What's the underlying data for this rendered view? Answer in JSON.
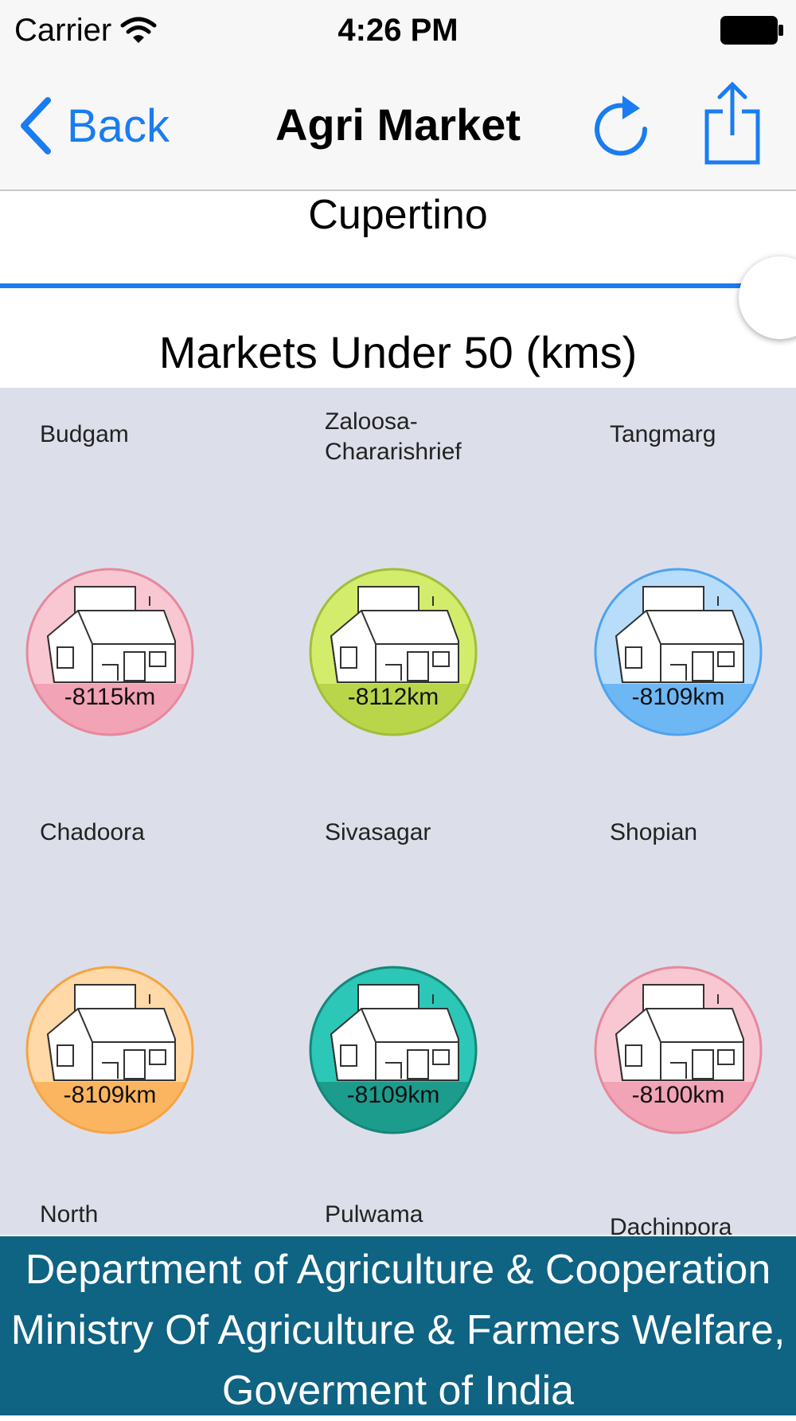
{
  "status_bar": {
    "carrier": "Carrier",
    "time": "4:26 PM"
  },
  "nav": {
    "back_label": "Back",
    "title": "Agri Market"
  },
  "location": {
    "name": "Cupertino"
  },
  "radius": {
    "label": "Markets Under 50 (kms)"
  },
  "markets": [
    {
      "name": "Budgam",
      "distance": "-8115km",
      "color": "#f8c7d2",
      "band": "#f2a3b6",
      "border": "#e7889c"
    },
    {
      "name": "Zaloosa-Chararishrief",
      "distance": "-8112km",
      "color": "#d4ec6c",
      "band": "#b9d64a",
      "border": "#9fbf3a"
    },
    {
      "name": "Tangmarg",
      "distance": "-8109km",
      "color": "#b7ddfb",
      "band": "#6eb7f5",
      "border": "#4fa3ee"
    },
    {
      "name": "Chadoora",
      "distance": "-8109km",
      "color": "#ffd9a8",
      "band": "#fbb560",
      "border": "#f5a443"
    },
    {
      "name": "Sivasagar",
      "distance": "-8109km",
      "color": "#2cc7b6",
      "band": "#1c9c8d",
      "border": "#168678"
    },
    {
      "name": "Shopian",
      "distance": "-8100km",
      "color": "#f8c7d2",
      "band": "#f2a3b6",
      "border": "#e7889c"
    },
    {
      "name": "North",
      "distance": "",
      "color": "",
      "band": "",
      "border": ""
    },
    {
      "name": "Pulwama",
      "distance": "",
      "color": "",
      "band": "",
      "border": ""
    },
    {
      "name": "Dachinpora",
      "distance": "",
      "color": "",
      "band": "",
      "border": ""
    }
  ],
  "footer": {
    "line1": "Department of Agriculture & Cooperation",
    "line2": "Ministry Of Agriculture & Farmers Welfare,",
    "line3": "Goverment of India"
  },
  "colors": {
    "accent": "#1a7cf0",
    "footer_bg": "#0f6383",
    "grid_bg": "#dcdfea"
  },
  "icons": [
    "wifi-icon",
    "battery-icon",
    "back-chevron-icon",
    "refresh-icon",
    "share-icon",
    "market-house-icon"
  ]
}
